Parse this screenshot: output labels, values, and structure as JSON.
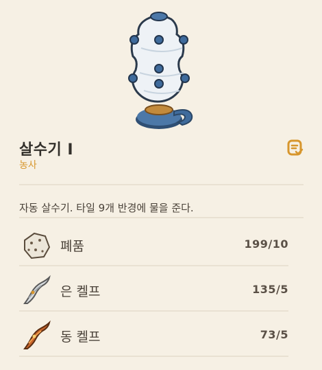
{
  "item": {
    "name": "살수기 I",
    "category": "농사",
    "description": "자동 살수기. 타일 9개 반경에 물을 준다."
  },
  "ingredients": [
    {
      "icon": "scrap-icon",
      "name": "폐품",
      "count": "199/10"
    },
    {
      "icon": "silver-kelp-icon",
      "name": "은 켈프",
      "count": "135/5"
    },
    {
      "icon": "copper-kelp-icon",
      "name": "동 켈프",
      "count": "73/5"
    }
  ],
  "colors": {
    "background": "#f6f0e4",
    "accent": "#d7962d",
    "divider": "#e9e1d2"
  }
}
